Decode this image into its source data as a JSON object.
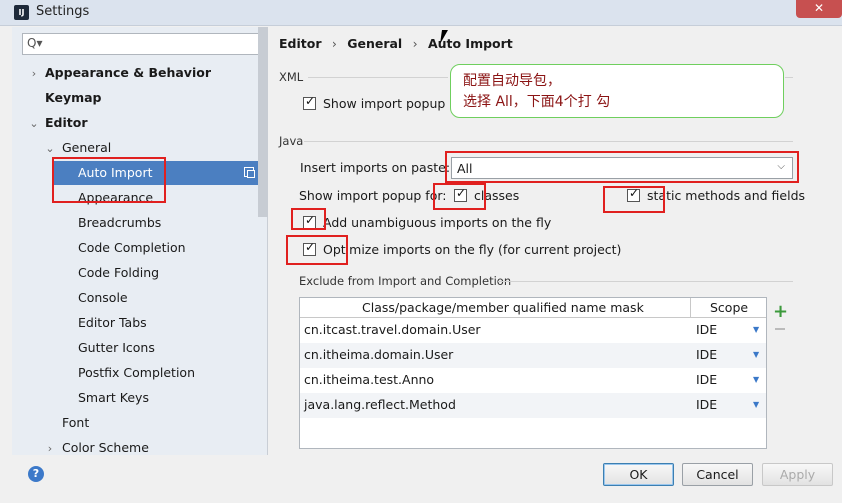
{
  "window": {
    "title": "Settings",
    "app_icon": "IJ"
  },
  "search": {
    "placeholder": "Q▾"
  },
  "tree": {
    "items": [
      {
        "label": "Appearance & Behavior",
        "chevron": "›"
      },
      {
        "label": "Keymap"
      },
      {
        "label": "Editor",
        "chevron": "⌄"
      },
      {
        "label": "General",
        "chevron": "⌄"
      },
      {
        "label": "Auto Import"
      },
      {
        "label": "Appearance"
      },
      {
        "label": "Breadcrumbs"
      },
      {
        "label": "Code Completion"
      },
      {
        "label": "Code Folding"
      },
      {
        "label": "Console"
      },
      {
        "label": "Editor Tabs"
      },
      {
        "label": "Gutter Icons"
      },
      {
        "label": "Postfix Completion"
      },
      {
        "label": "Smart Keys"
      },
      {
        "label": "Font"
      },
      {
        "label": "Color Scheme",
        "chevron": "›"
      }
    ]
  },
  "breadcrumb": {
    "part1": "Editor",
    "part2": "General",
    "part3": "Auto Import",
    "sep": "›"
  },
  "xml": {
    "section": "XML",
    "show_popup": "Show import popup"
  },
  "java": {
    "section": "Java",
    "insert_label": "Insert imports on paste:",
    "insert_value": "All",
    "show_popup_for": "Show import popup for:",
    "classes": "classes",
    "static": "static methods and fields",
    "add_unambiguous": "Add unambiguous imports on the fly",
    "optimize": "Optimize imports on the fly (for current project)"
  },
  "exclude": {
    "section": "Exclude from Import and Completion",
    "col_mask": "Class/package/member qualified name mask",
    "col_scope": "Scope",
    "rows": [
      {
        "name": "cn.itcast.travel.domain.User",
        "scope": "IDE"
      },
      {
        "name": "cn.itheima.domain.User",
        "scope": "IDE"
      },
      {
        "name": "cn.itheima.test.Anno",
        "scope": "IDE"
      },
      {
        "name": "java.lang.reflect.Method",
        "scope": "IDE"
      }
    ],
    "plus": "+"
  },
  "buttons": {
    "help": "?",
    "ok": "OK",
    "cancel": "Cancel",
    "apply": "Apply"
  },
  "annotation": {
    "line1": "配置自动导包，",
    "line2": "选择 All，下面4个打 勾"
  },
  "colors": {
    "accent": "#4b7fc1",
    "annotation_red": "#e0201f",
    "callout_border": "#6fcf5e"
  }
}
